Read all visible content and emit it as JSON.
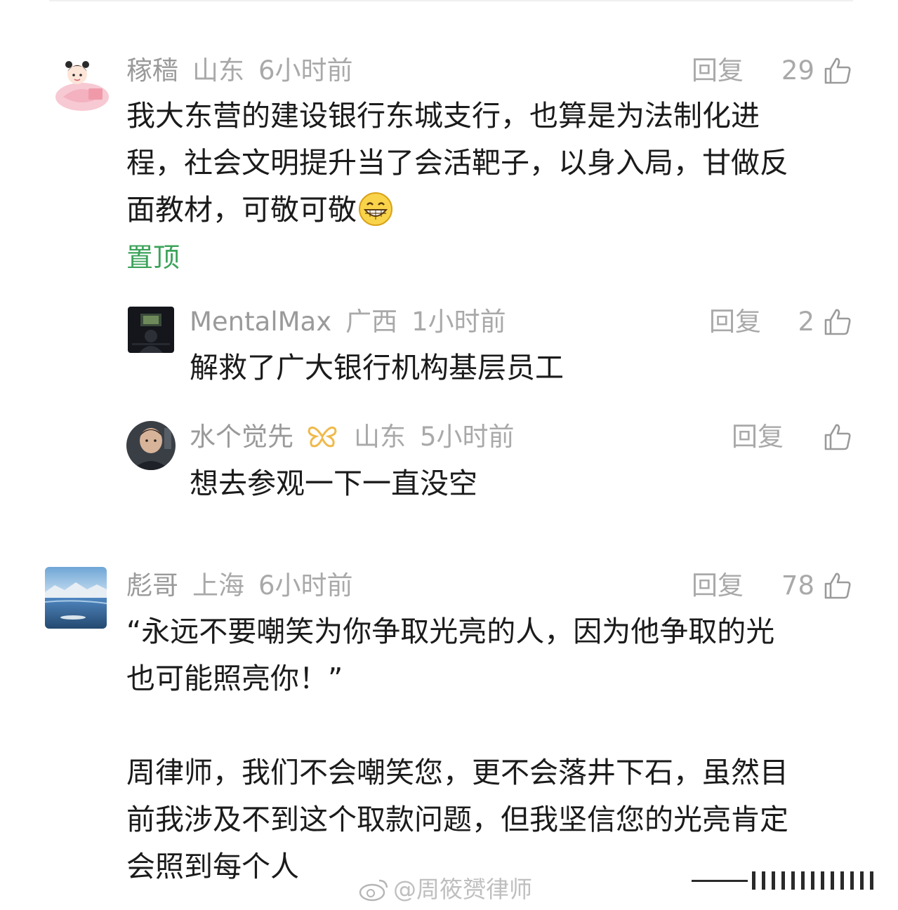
{
  "comments": [
    {
      "username": "稼穑",
      "location": "山东",
      "time": "6小时前",
      "reply_label": "回复",
      "likes": "29",
      "lines": [
        "我大东营的建设银行东城支行，也算是为法制化进",
        "程，社会文明提升当了会活靶子，以身入局，甘做反",
        "面教材，可敬可敬"
      ],
      "emoji": "grinning-face",
      "pinned_label": "置顶",
      "replies": [
        {
          "username": "MentalMax",
          "location": "广西",
          "time": "1小时前",
          "reply_label": "回复",
          "likes": "2",
          "text": "解救了广大银行机构基层员工"
        },
        {
          "username": "水个觉先",
          "badge": "butterfly-vip-icon",
          "location": "山东",
          "time": "5小时前",
          "reply_label": "回复",
          "likes": "",
          "text": "想去参观一下一直没空"
        }
      ]
    },
    {
      "username": "彪哥",
      "location": "上海",
      "time": "6小时前",
      "reply_label": "回复",
      "likes": "78",
      "lines": [
        "“永远不要嘲笑为你争取光亮的人，因为他争取的光",
        "也可能照亮你！”",
        "",
        "周律师，我们不会嘲笑您，更不会落井下石，虽然目",
        "前我涉及不到这个取款问题，但我坚信您的光亮肯定",
        "会照到每个人"
      ]
    }
  ],
  "watermark": "@周筱赟律师",
  "colors": {
    "pinned": "#3ba35a",
    "meta": "#a9a9a9",
    "text": "#1b1b1b",
    "badge": "#f0b94a"
  }
}
